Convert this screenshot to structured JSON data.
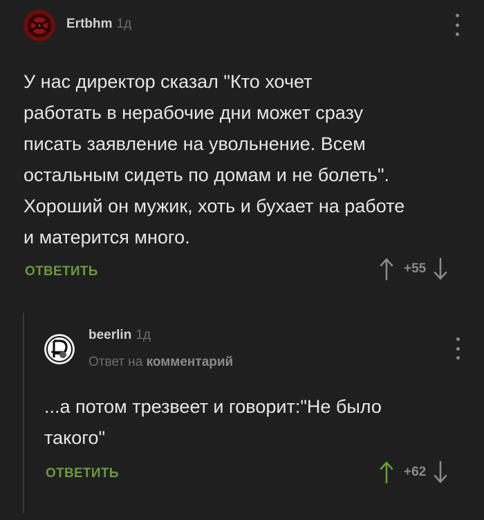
{
  "comments": [
    {
      "username": "Ertbhm",
      "time": "1д",
      "text": "У нас директор сказал \"Кто хочет\nработать в нерабочие дни может сразу\nписать заявление на увольнение. Всем\nостальным сидеть по домам и не болеть\".\nХороший он мужик, хоть и бухает на работе\nи матерится много.",
      "reply_label": "ОТВЕТИТЬ",
      "score": "+55",
      "colors": {
        "upvote": "#8a8a8a",
        "downvote": "#8a8a8a"
      }
    },
    {
      "username": "beerlin",
      "time": "1д",
      "reply_prefix": "Ответ на",
      "reply_target": "комментарий",
      "text": "...а потом трезвеет и говорит:\"Не было\nтакого\"",
      "reply_label": "ОТВЕТИТЬ",
      "score": "+62",
      "colors": {
        "upvote": "#6a9a3c",
        "downvote": "#8a8a8a"
      }
    }
  ],
  "colors": {
    "background": "#1f1f1f",
    "accent": "#6a9a3c",
    "text": "#e6e6e6",
    "muted": "#6d6d6d"
  }
}
